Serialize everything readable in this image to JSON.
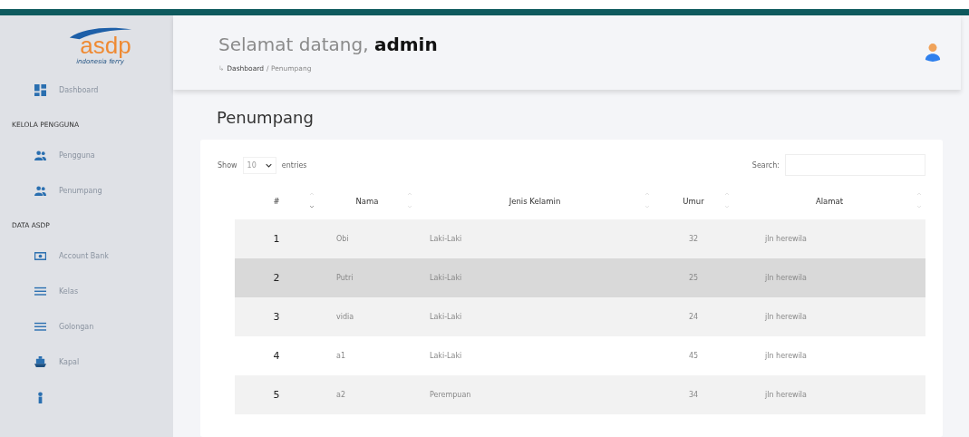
{
  "sidebar": {
    "logo": {
      "text": "asdp",
      "tagline": "indonesia ferry"
    },
    "items": [
      {
        "kind": "item",
        "label": "Dashboard"
      },
      {
        "kind": "section",
        "label": "KELOLA PENGGUNA"
      },
      {
        "kind": "item",
        "label": "Pengguna"
      },
      {
        "kind": "item",
        "label": "Penumpang"
      },
      {
        "kind": "section",
        "label": "DATA ASDP"
      },
      {
        "kind": "item",
        "label": "Account Bank"
      },
      {
        "kind": "item",
        "label": "Kelas"
      },
      {
        "kind": "item",
        "label": "Golongan"
      },
      {
        "kind": "item",
        "label": "Kapal"
      },
      {
        "kind": "item"
      }
    ]
  },
  "header": {
    "greeting": "Selamat datang, **admin**",
    "breadcrumb": {
      "arrow": "↳",
      "link": "Dashboard",
      "rest": "/ Penumpang"
    }
  },
  "page_title": "Penumpang",
  "table": {
    "length": {
      "before": "Show",
      "value": "10",
      "after": "entries"
    },
    "search": {
      "label": "Search:"
    },
    "columns": [
      {
        "label": "#",
        "sorted": true
      },
      {
        "label": "Nama",
        "sorted": false
      },
      {
        "label": "Jenis Kelamin",
        "sorted": false
      },
      {
        "label": "Umur",
        "sorted": false
      },
      {
        "label": "Alamat",
        "sorted": false
      }
    ],
    "rows": [
      {
        "cells": [
          "1",
          "Obi",
          "Laki-Laki",
          "32",
          "jln herewila"
        ],
        "hovered": false
      },
      {
        "cells": [
          "2",
          "Putri",
          "Laki-Laki",
          "25",
          "jln herewila"
        ],
        "hovered": true
      },
      {
        "cells": [
          "3",
          "vidia",
          "Laki-Laki",
          "24",
          "jln herewila"
        ],
        "hovered": false
      },
      {
        "cells": [
          "4",
          "a1",
          "Laki-Laki",
          "45",
          "jln herewila"
        ],
        "hovered": false
      },
      {
        "cells": [
          "5",
          "a2",
          "Perempuan",
          "34",
          "jln herewila"
        ],
        "hovered": false
      }
    ]
  }
}
